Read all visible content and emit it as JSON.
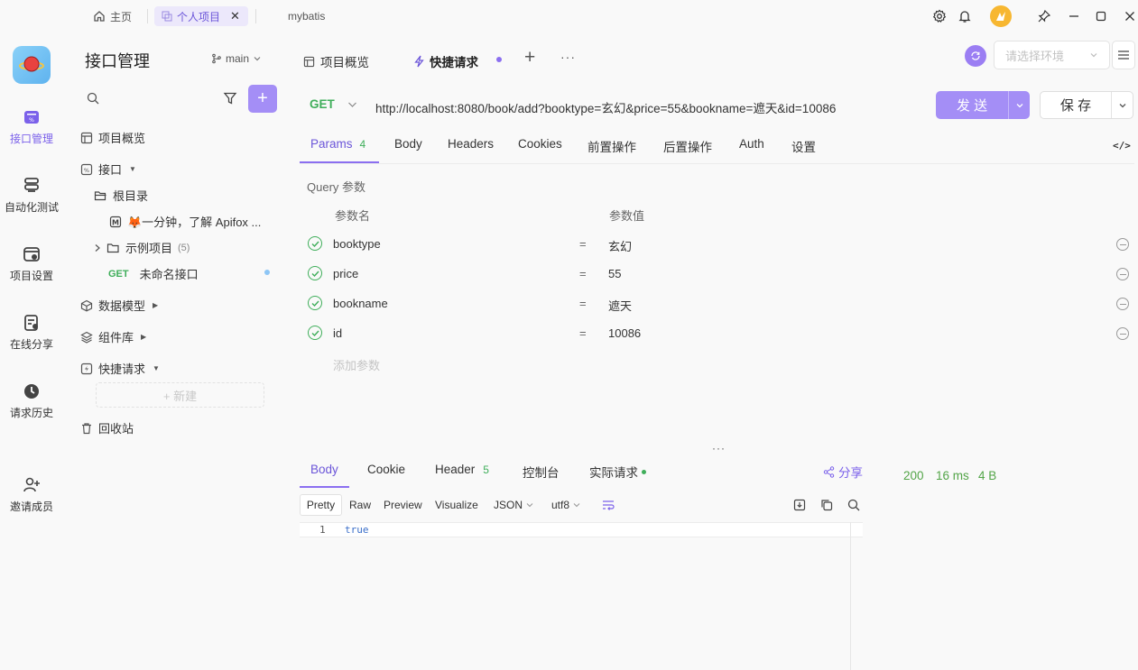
{
  "titlebar": {
    "home_label": "主页",
    "active_tab_label": "个人项目",
    "close_glyph": "✕",
    "other_tab_label": "mybatis"
  },
  "rail": {
    "items": [
      {
        "label": "接口管理",
        "icon": "api-manage-icon"
      },
      {
        "label": "自动化测试",
        "icon": "auto-test-icon"
      },
      {
        "label": "项目设置",
        "icon": "project-settings-icon"
      },
      {
        "label": "在线分享",
        "icon": "share-icon"
      },
      {
        "label": "请求历史",
        "icon": "history-icon"
      },
      {
        "label": "邀请成员",
        "icon": "invite-icon"
      }
    ]
  },
  "sidebar": {
    "title": "接口管理",
    "branch": "main",
    "plus": "+",
    "overview": "项目概览",
    "api": "接口",
    "root": "根目录",
    "doc": "🦊一分钟，了解 Apifox ...",
    "example": "示例项目",
    "example_count": "(5)",
    "get_method": "GET",
    "unnamed": "未命名接口",
    "data_model": "数据模型",
    "components": "组件库",
    "quick": "快捷请求",
    "new": "+ 新建",
    "trash": "回收站"
  },
  "header": {
    "tab_overview": "项目概览",
    "tab_quick": "快捷请求",
    "env_placeholder": "请选择环境",
    "plus": "+",
    "more": "···"
  },
  "request": {
    "method": "GET",
    "url": "http://localhost:8080/book/add?booktype=玄幻&price=55&bookname=遮天&id=10086",
    "send": "发 送",
    "save": "保 存"
  },
  "req_tabs": {
    "params": "Params",
    "params_count": "4",
    "body": "Body",
    "headers": "Headers",
    "cookies": "Cookies",
    "pre": "前置操作",
    "post": "后置操作",
    "auth": "Auth",
    "settings": "设置",
    "code": "</>"
  },
  "params": {
    "section": "Query 参数",
    "col_name": "参数名",
    "col_value": "参数值",
    "eq": "=",
    "rows": [
      {
        "name": "booktype",
        "value": "玄幻"
      },
      {
        "name": "price",
        "value": "55"
      },
      {
        "name": "bookname",
        "value": "遮天"
      },
      {
        "name": "id",
        "value": "10086"
      }
    ],
    "add": "添加参数"
  },
  "response": {
    "divider": "···",
    "tab_body": "Body",
    "tab_cookie": "Cookie",
    "tab_header": "Header",
    "header_count": "5",
    "tab_console": "控制台",
    "tab_actual": "实际请求",
    "share": "分享",
    "status": "200",
    "time": "16 ms",
    "size": "4 B",
    "fmt_pretty": "Pretty",
    "fmt_raw": "Raw",
    "fmt_preview": "Preview",
    "fmt_visualize": "Visualize",
    "fmt_json": "JSON",
    "fmt_utf8": "utf8",
    "line_no": "1",
    "body_text": "true"
  },
  "colors": {
    "accent": "#8b6ff0",
    "green": "#3fae5a",
    "status_green": "#52a447"
  }
}
